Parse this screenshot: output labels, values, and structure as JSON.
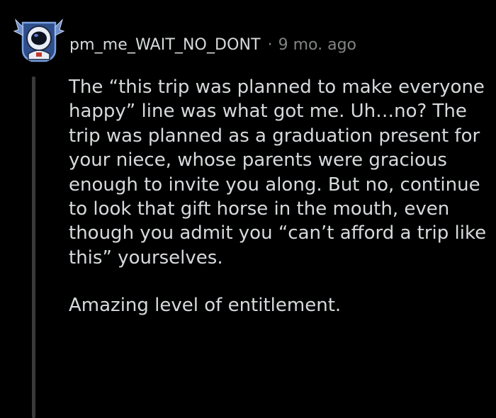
{
  "comment": {
    "username": "pm_me_WAIT_NO_DONT",
    "separator": "·",
    "timestamp": "9 mo. ago",
    "avatar_icon": "astronaut-avatar-icon",
    "paragraphs": [
      "The “this trip was planned to make everyone happy” line was what got me. Uh…no? The trip was planned as a graduation present for your niece, whose parents were gracious enough to invite you along. But no, continue to look that gift horse in the mouth, even though you admit you “can’t afford a trip like this” yourselves.",
      "Amazing level of entitlement."
    ]
  },
  "colors": {
    "background": "#000000",
    "text": "#d7dadc",
    "meta_text": "#818384",
    "thread_line": "#3a3a3c",
    "avatar_accent": "#2f4e8c"
  }
}
